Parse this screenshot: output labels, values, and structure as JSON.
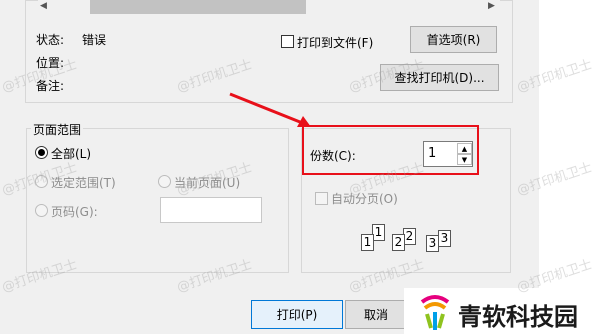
{
  "printer": {
    "status_label": "状态:",
    "status_value": "错误",
    "location_label": "位置:",
    "comment_label": "备注:",
    "print_to_file_label": "打印到文件(F)",
    "preferences_button": "首选项(R)",
    "find_printer_button": "查找打印机(D)..."
  },
  "page_range": {
    "title": "页面范围",
    "all_label": "全部(L)",
    "selection_label": "选定范围(T)",
    "current_page_label": "当前页面(U)",
    "pages_label": "页码(G):",
    "pages_value": ""
  },
  "copies": {
    "label": "份数(C):",
    "value": "1",
    "collate_label": "自动分页(O)",
    "collate_pages": [
      "1",
      "1",
      "2",
      "2",
      "3",
      "3"
    ]
  },
  "buttons": {
    "print": "打印(P)",
    "cancel": "取消"
  },
  "watermark_text": "@打印机卫士",
  "logo_text": "青软科技园",
  "colors": {
    "highlight": "#e8101a",
    "arrow": "#e8101a",
    "logo_text": "#1a1a1a"
  }
}
